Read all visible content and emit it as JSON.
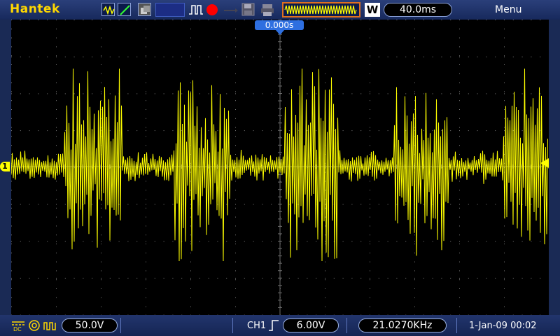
{
  "brand": "Hantek",
  "toolbar": {
    "timebase": "40.0ms",
    "mode": "W",
    "menu": "Menu"
  },
  "trigger_position": "0.000s",
  "channel_marker": "1",
  "bottom": {
    "ch_volts": "50.0V",
    "trigger_source": "CH1",
    "trigger_level": "6.00V",
    "frequency": "21.0270KHz",
    "datetime": "1-Jan-09 00:02"
  },
  "colors": {
    "trace": "#ffff00",
    "brand": "#ffd800",
    "record_accent": "#e07020"
  }
}
